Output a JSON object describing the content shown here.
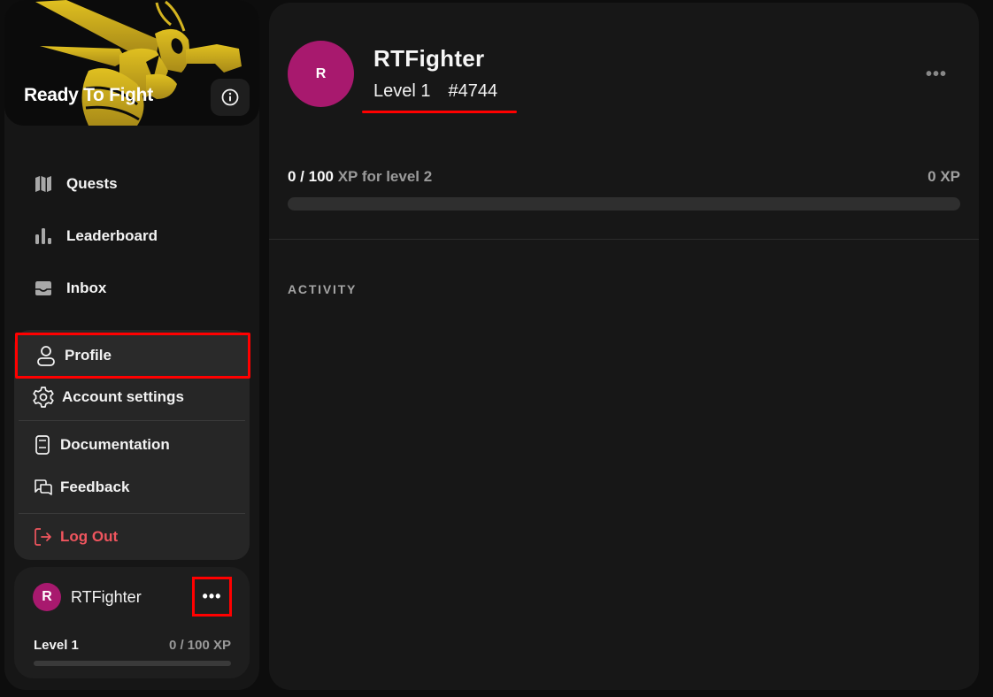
{
  "brand": {
    "title": "Ready To Fight",
    "logo_icon": "hornet-boxer-logo",
    "logo_color": "#c9a91e",
    "info_icon": "info-icon"
  },
  "nav": {
    "items": [
      {
        "label": "Quests",
        "icon": "map-icon"
      },
      {
        "label": "Leaderboard",
        "icon": "bar-chart-icon"
      },
      {
        "label": "Inbox",
        "icon": "inbox-icon"
      }
    ]
  },
  "menu": {
    "items": [
      {
        "label": "Profile",
        "icon": "user-icon",
        "highlighted": true
      },
      {
        "label": "Account settings",
        "icon": "gear-icon"
      },
      {
        "label": "Documentation",
        "icon": "book-icon"
      },
      {
        "label": "Feedback",
        "icon": "chat-bubbles-icon"
      },
      {
        "label": "Log Out",
        "icon": "logout-icon",
        "color": "#f0555e"
      }
    ]
  },
  "user_card": {
    "initial": "R",
    "name": "RTFighter",
    "more": "•••",
    "level": "Level 1",
    "xp": "0 / 100 XP",
    "progress": 0
  },
  "profile": {
    "initial": "R",
    "name": "RTFighter",
    "level": "Level 1",
    "tag": "#4744",
    "more": "•••",
    "avatar_color": "#a8196e"
  },
  "xp": {
    "current": "0 / 100",
    "suffix": " XP for level 2",
    "total": "0 XP",
    "progress": 0
  },
  "activity": {
    "heading": "ACTIVITY"
  },
  "annotations": {
    "highlight_color": "#ff0000"
  }
}
